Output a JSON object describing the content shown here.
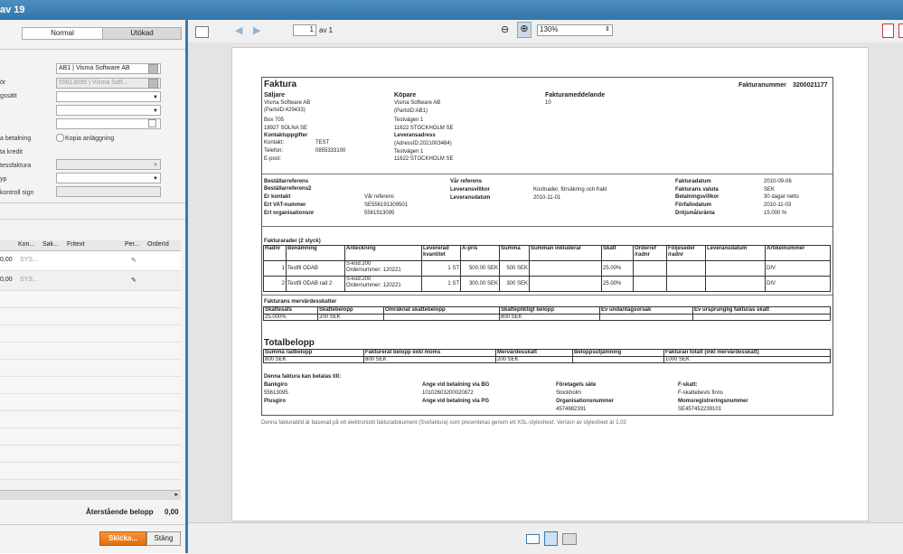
{
  "header": {
    "title": "av 19"
  },
  "left": {
    "mode_normal": "Normal",
    "mode_utokad": "Utökad",
    "field_company_label": "",
    "company_value": "AB1 | Visma Software AB",
    "supplier_label": "ör",
    "supplier_value": "55613095 | Visma Soft...",
    "payment_method_label": "gssätt",
    "payment_label": "a betalning",
    "copy_asset": "Kopia anläggning",
    "credit_label": "ta kredit",
    "invoice_type_label": "tessfaktura",
    "type_label": "yp",
    "control_sign_label": "kontroll sign",
    "grid_headers": [
      "Kon...",
      "Sak...",
      "Fritext",
      "Per...",
      "OrderId"
    ],
    "rows": [
      {
        "amount": "0,00",
        "kon": "SYS..."
      },
      {
        "amount": "0,00",
        "kon": "SYS..."
      }
    ],
    "remaining_label": "Återstående belopp",
    "remaining_value": "0,00",
    "send_button": "Skicka...",
    "close_button": "Stäng"
  },
  "toolbar": {
    "page_value": "1",
    "page_of": "av 1",
    "zoom_value": "130%"
  },
  "invoice": {
    "title": "Faktura",
    "invoice_number_label": "Fakturanummer",
    "invoice_number": "3200021177",
    "seller_head": "Säljare",
    "seller_name": "Visma Software AB",
    "seller_party": "(PartsID:429433)",
    "seller_box": "Box 705",
    "seller_city": "18927 SOLNA SE",
    "contact_head": "Kontaktuppgifter",
    "contact_label": "Kontakt:",
    "contact_value": "TEST",
    "phone_label": "Telefon:",
    "phone_value": "0855333100",
    "email_label": "E-post:",
    "buyer_head": "Köpare",
    "buyer_name": "Visma Software AB",
    "buyer_party": "(PartsID:AB1)",
    "buyer_street": "Testvägen 1",
    "buyer_city": "11622 STOCKHOLM SE",
    "delivery_head": "Leveransadress",
    "delivery_id": "(AdressID:2021003484)",
    "delivery_street": "Testvägen 1",
    "delivery_city": "11622 STOCKHOLM SE",
    "message_head": "Fakturameddelande",
    "message_value": "10",
    "ref1": "Beställarreferens",
    "ref2": "Beställarreferens2",
    "our_contact": "Er kontakt",
    "our_contact_val": "Vår referens",
    "vat_label": "Ert VAT-nummer",
    "vat_value": "SE556191309501",
    "org_label": "Ert organisationsnr",
    "org_value": "5561913095",
    "our_ref": "Vår referens",
    "delivery_terms": "Leveransvillkor",
    "delivery_terms_val": "Kostnader, försäkring och frakt",
    "delivery_date": "Leveransdatum",
    "delivery_date_val": "2010-11-01",
    "inv_date": "Fakturadatum",
    "inv_date_val": "2010-09-06",
    "currency": "Fakturans valuta",
    "currency_val": "SEK",
    "pay_terms": "Betalningsvillkor",
    "pay_terms_val": "30 dagar netto",
    "due": "Förfallodatum",
    "due_val": "2010-11-03",
    "interest": "Dröjsmålsränta",
    "interest_val": "15.000 %",
    "rows_title": "Fakturarader (2 styck)",
    "row_headers": [
      "Radnr",
      "Benämning",
      "Anteckning",
      "Levererad kvantitet",
      "A-pris",
      "Summa",
      "Summan inkluderar",
      "Skatt",
      "Orderref /radnr",
      "Följesedel /radnr",
      "Leveransdatum",
      "Artikelnummer"
    ],
    "rows": [
      {
        "nr": "1",
        "name": "Testfil ODAB",
        "note1": "S-kod:200",
        "note2": "Ordernummer: 120221",
        "qty": "1 ST",
        "price": "500.00 SEK",
        "sum": "500 SEK",
        "tax": "25.00%",
        "art": "DIV"
      },
      {
        "nr": "2",
        "name": "Testfil ODAB rad 2",
        "note1": "S-kod:200",
        "note2": "Ordernummer: 120221",
        "qty": "1 ST",
        "price": "300.00 SEK",
        "sum": "300 SEK",
        "tax": "25.00%",
        "art": "DIV"
      }
    ],
    "vat_title": "Fakturans mervärdesskatter",
    "vat_headers": [
      "Skattesats",
      "Skattebelopp",
      "Omräknat skattebelopp",
      "Skattepliktigt belopp",
      "Ev undantagsorsak",
      "Ev ursprunglig fakturas skatt"
    ],
    "vat_row": [
      "25.000%",
      "200 SEK",
      "",
      "800 SEK",
      "",
      ""
    ],
    "total_title": "Totalbelopp",
    "total_headers": [
      "Summa radbelopp",
      "Fakturerat belopp exkl moms",
      "Mervärdesskatt",
      "Beloppsutjämning",
      "Fakturan totalt (inkl mervärdesskatt)"
    ],
    "total_row": [
      "800 SEK",
      "800 SEK",
      "200 SEK",
      "",
      "1000 SEK"
    ],
    "pay_title": "Denna faktura kan betalas till:",
    "bankgiro": "Bankgiro",
    "bankgiro_val": "55613095",
    "plusgiro": "Plusgiro",
    "bg_label": "Ange vid betalning via BG",
    "bg_val": "10102603200020872",
    "pg_label": "Ange vid betalning via PG",
    "seat": "Företagets säte",
    "seat_val": "Stockholm",
    "orgnr": "Organisationsnummer",
    "orgnr_val": "4574882391",
    "fskatt": "F-skatt:",
    "fskatt_val": "F-skattebevis finns",
    "vatreg": "Momsregistreringsnummer",
    "vatreg_val": "SE457452239101",
    "footer": "Denna fakturabild är baserad på ett elektroniskt fakturadokument (Svefaktura) som presenteras genom ett XSL-stylesheet. Version av stylesheet är 1.03"
  }
}
